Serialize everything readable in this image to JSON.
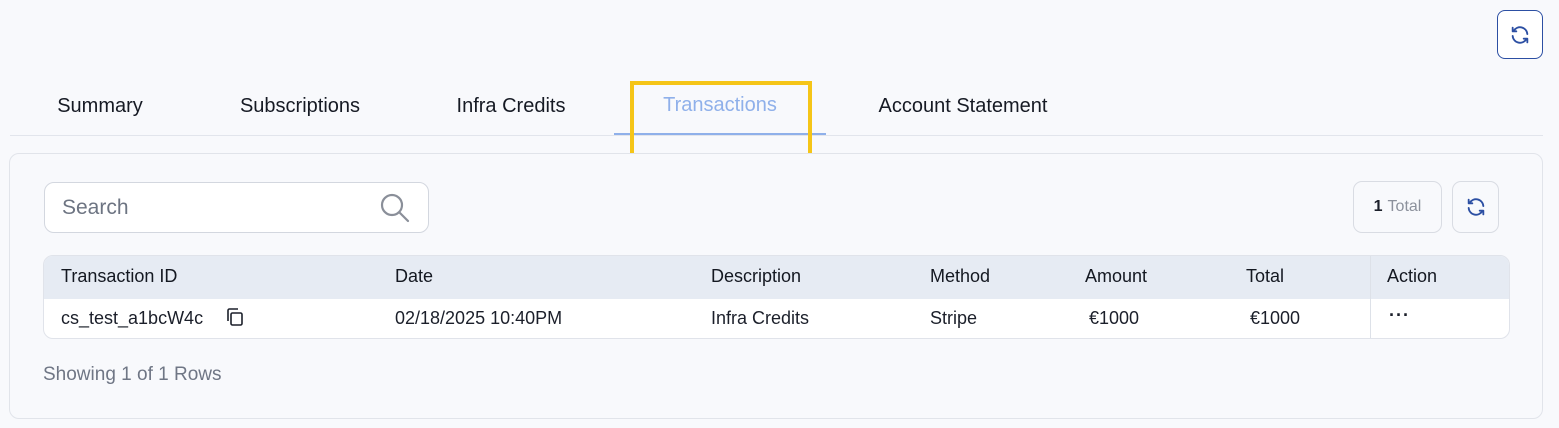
{
  "header": {
    "refresh_icon": "refresh-icon"
  },
  "tabs": [
    {
      "label": "Summary"
    },
    {
      "label": "Subscriptions"
    },
    {
      "label": "Infra Credits"
    },
    {
      "label": "Transactions"
    },
    {
      "label": "Account Statement"
    }
  ],
  "active_tab": "Transactions",
  "search": {
    "placeholder": "Search",
    "value": "",
    "icon": "search-icon"
  },
  "summary": {
    "count": "1",
    "count_label": "Total"
  },
  "table": {
    "columns": [
      "Transaction ID",
      "Date",
      "Description",
      "Method",
      "Amount",
      "Total",
      "Action"
    ],
    "rows": [
      {
        "transaction_id": "cs_test_a1bcW4c",
        "date": "02/18/2025 10:40PM",
        "description": "Infra Credits",
        "method": "Stripe",
        "amount": "€1000",
        "total": "€1000",
        "action": "···"
      }
    ]
  },
  "footer": {
    "rows_text": "Showing 1 of 1 Rows"
  },
  "colors": {
    "accent": "#2c4fa3",
    "active_tab": "#8fb0ea",
    "highlight": "#f5c518",
    "table_header_bg": "#e6ebf3"
  }
}
